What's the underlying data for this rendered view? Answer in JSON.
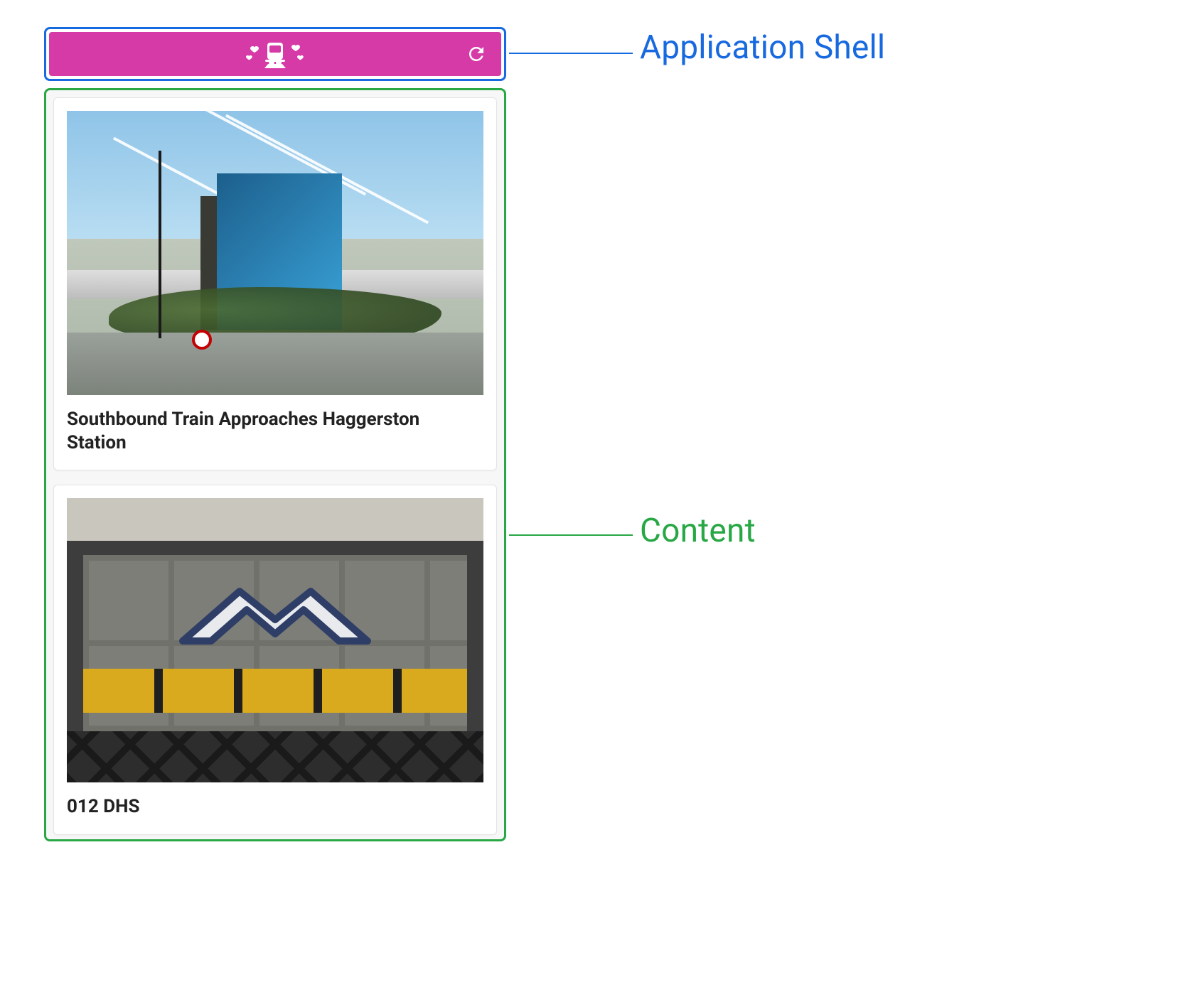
{
  "annotations": {
    "shell_label": "Application Shell",
    "content_label": "Content"
  },
  "colors": {
    "shell_border": "#1769e0",
    "content_border": "#28a745",
    "header_bg": "#d63aa7"
  },
  "header": {
    "logo_name": "train-hearts-icon",
    "refresh_name": "refresh-icon"
  },
  "cards": [
    {
      "title": "Southbound Train Approaches Haggerston Station"
    },
    {
      "title": "012 DHS"
    }
  ]
}
